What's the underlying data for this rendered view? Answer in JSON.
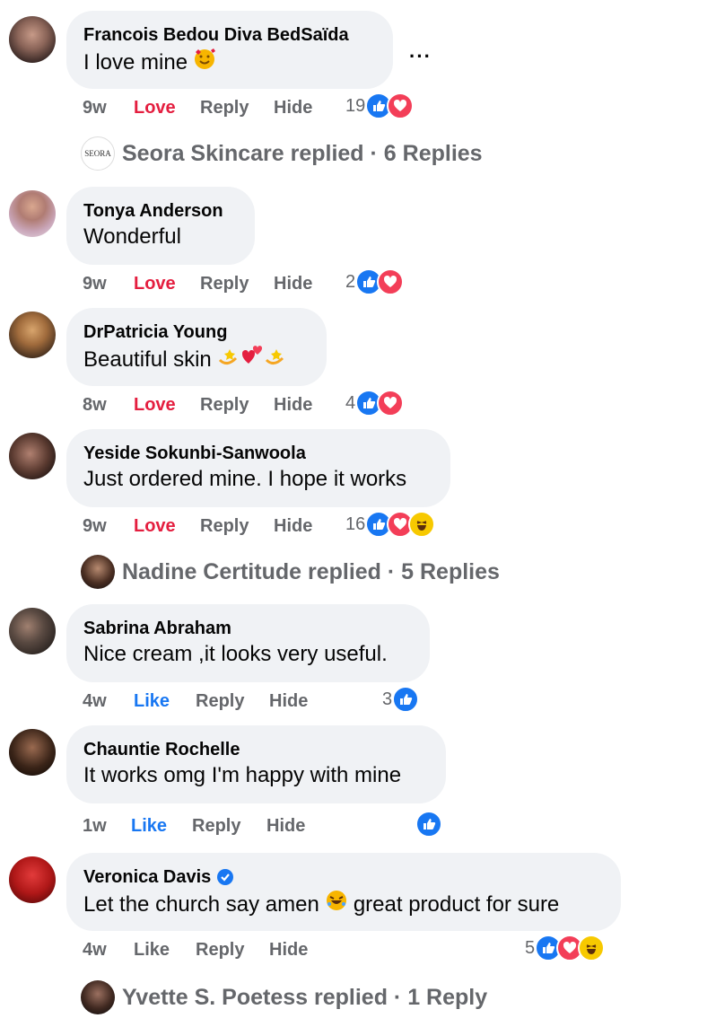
{
  "comments": [
    {
      "name": "Francois Bedou Diva BedSaïda",
      "text": "I love mine",
      "time": "9w",
      "reaction_label": "Love",
      "reply": "Reply",
      "hide": "Hide",
      "count": "19"
    },
    {
      "name": "Tonya Anderson",
      "text": "Wonderful",
      "time": "9w",
      "reaction_label": "Love",
      "reply": "Reply",
      "hide": "Hide",
      "count": "2"
    },
    {
      "name": "DrPatricia Young",
      "text": "Beautiful skin",
      "time": "8w",
      "reaction_label": "Love",
      "reply": "Reply",
      "hide": "Hide",
      "count": "4"
    },
    {
      "name": "Yeside Sokunbi-Sanwoola",
      "text": "Just ordered mine. I hope it works",
      "time": "9w",
      "reaction_label": "Love",
      "reply": "Reply",
      "hide": "Hide",
      "count": "16"
    },
    {
      "name": "Sabrina Abraham",
      "text": "Nice cream ,it looks very useful.",
      "time": "4w",
      "reaction_label": "Like",
      "reply": "Reply",
      "hide": "Hide",
      "count": "3"
    },
    {
      "name": "Chauntie Rochelle",
      "text": "It works omg I'm happy with mine",
      "time": "1w",
      "reaction_label": "Like",
      "reply": "Reply",
      "hide": "Hide",
      "count": ""
    },
    {
      "name": "Veronica Davis",
      "text_before": "Let the church say amen",
      "text_after": "great product for sure",
      "time": "4w",
      "reaction_label": "Like",
      "reply": "Reply",
      "hide": "Hide",
      "count": "5"
    }
  ],
  "replies": [
    {
      "text": "Seora Skincare replied · 6 Replies",
      "avatar_text": "SEORA"
    },
    {
      "text": "Nadine Certitude replied · 5 Replies"
    },
    {
      "text": "Yvette S. Poetess replied · 1 Reply"
    }
  ],
  "more_icon": "···",
  "colors": {
    "love": "#e41e3f",
    "like": "#1877f2",
    "muted": "#65676b",
    "bubble": "#f0f2f5"
  }
}
